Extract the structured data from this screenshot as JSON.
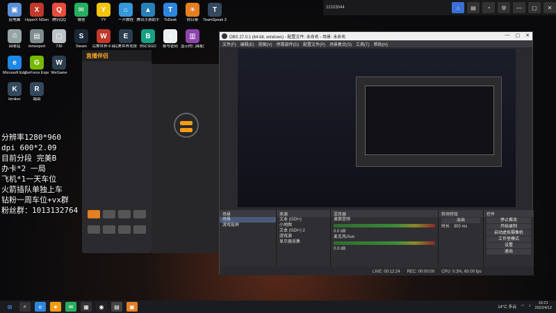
{
  "desktop_icons": [
    {
      "label": "此电脑",
      "color": "#5b8fd8",
      "glyph": "▣"
    },
    {
      "label": "HyperX NGenuity",
      "color": "#c0392b",
      "glyph": "X"
    },
    {
      "label": "腾讯QQ",
      "color": "#e74c3c",
      "glyph": "Q"
    },
    {
      "label": "微信",
      "color": "#27ae60",
      "glyph": "✉"
    },
    {
      "label": "YY",
      "color": "#f1c40f",
      "glyph": "Y"
    },
    {
      "label": "一开教程",
      "color": "#3498db",
      "glyph": "⌂"
    },
    {
      "label": "腾讯手游助手",
      "color": "#2980b9",
      "glyph": "▲"
    },
    {
      "label": "ToDesk",
      "color": "#2e86de",
      "glyph": "T"
    },
    {
      "label": "向日葵",
      "color": "#e67e22",
      "glyph": "☀"
    },
    {
      "label": "TeamSpeak 3",
      "color": "#34495e",
      "glyph": "T"
    },
    {
      "label": "回收站",
      "color": "#95a5a6",
      "glyph": "♲"
    },
    {
      "label": "mmexport",
      "color": "#7f8c8d",
      "glyph": "▤"
    },
    {
      "label": "730",
      "color": "#bdc3c7",
      "glyph": "▢"
    },
    {
      "label": "Steam",
      "color": "#1b2838",
      "glyph": "S"
    },
    {
      "label": "完美世界平台",
      "color": "#c0392b",
      "glyph": "W"
    },
    {
      "label": "完美世界竞技平台",
      "color": "#2c3e50",
      "glyph": "E"
    },
    {
      "label": "BSCSGO",
      "color": "#16a085",
      "glyph": "B"
    },
    {
      "label": "账号密码",
      "color": "#ecf0f1",
      "glyph": "≡"
    },
    {
      "label": "显示的门面配置",
      "color": "#8e44ad",
      "glyph": "▥"
    },
    {
      "label": "Microsoft Edge",
      "color": "#1e88e5",
      "glyph": "e"
    },
    {
      "label": "GeForce Experience",
      "color": "#76b900",
      "glyph": "G"
    },
    {
      "label": "WeGame",
      "color": "#2c3e50",
      "glyph": "W"
    },
    {
      "label": "kimiker",
      "color": "#34495e",
      "glyph": "K"
    },
    {
      "label": "路由",
      "color": "#34495e",
      "glyph": "R"
    }
  ],
  "side_app": {
    "brand": "直播伴侣"
  },
  "overlay_lines": [
    "分辨率1280*960",
    "dpi 600*2.09",
    "目前分段 完美B",
    "办卡*2 一局",
    "飞机*1一天车位",
    "火箭插队单独上车",
    "钻粉一周车位+vx群",
    "粉丝群：1013132764"
  ],
  "topbar": {
    "title": "22103044",
    "nav": [
      "⌂",
      "▤",
      "◔",
      "⚙",
      "—",
      "▢",
      "✕"
    ]
  },
  "obs": {
    "title": "OBS 27.0.1 (64-bit, windows) - 配置文件: 未命名 - 场景: 未命名",
    "menu": [
      "文件(F)",
      "编辑(E)",
      "视图(V)",
      "停靠部件(D)",
      "配置文件(P)",
      "场景集合(S)",
      "工具(T)",
      "帮助(H)"
    ],
    "docks": {
      "scenes": {
        "title": "场景",
        "items": [
          "场景",
          "游戏投屏"
        ]
      },
      "sources": {
        "title": "来源",
        "items": [
          "文本 (GDI+)",
          "小地图",
          "文本 (GDI+) 2",
          "游戏源",
          "显示器采集"
        ]
      },
      "mixer": {
        "title": "混音器",
        "tracks": [
          {
            "name": "桌面音频",
            "db": "0.0 dB"
          },
          {
            "name": "麦克风/Aux",
            "db": "0.0 dB"
          }
        ]
      },
      "transitions": {
        "title": "转场特效",
        "type": "淡出",
        "duration_label": "时长",
        "duration": "300 ms"
      },
      "controls": {
        "title": "控件",
        "buttons": [
          "停止推流",
          "开始录制",
          "启动虚拟摄像机",
          "工作室模式",
          "设置",
          "退出"
        ]
      }
    },
    "status": [
      "LIVE: 00:12:24",
      "REC: 00:00:00",
      "CPU: 0.3%, 60.00 fps"
    ]
  },
  "taskbar": {
    "weather": "14°C 多云",
    "time": "16:21",
    "date": "2022/4/12"
  }
}
